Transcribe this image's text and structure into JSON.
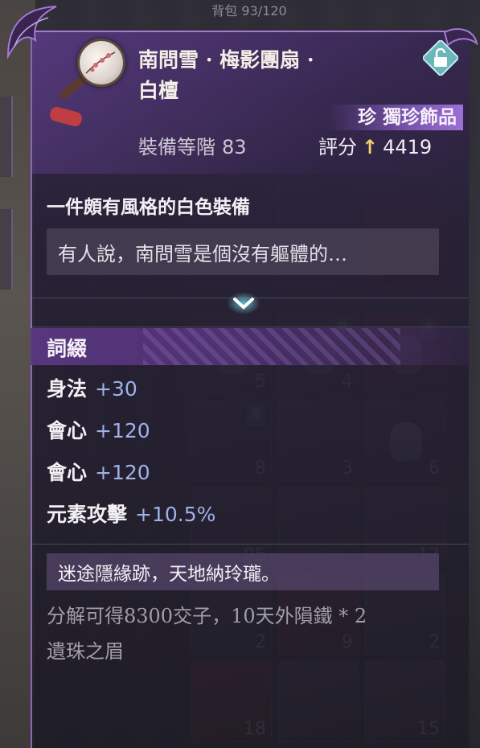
{
  "header": {
    "title_partial": "背包 93/120"
  },
  "item": {
    "name": "南問雪 · 梅影團扇 · 白檀",
    "quality": "珍 獨珍飾品",
    "equip_level_label": "裝備等階",
    "equip_level_value": "83",
    "score_label": "評分",
    "score_arrow": "↑",
    "score_value": "4419",
    "description_title": "一件頗有風格的白色裝備",
    "lore_text": "有人說，南問雪是個沒有軀體的…",
    "affix_title": "詞綴",
    "stats": [
      {
        "name": "身法",
        "value": "+30"
      },
      {
        "name": "會心",
        "value": "+120"
      },
      {
        "name": "會心",
        "value": "+120"
      },
      {
        "name": "元素攻擊",
        "value": "+10.5%"
      }
    ],
    "flavor_text": "迷途隱緣跡，天地納玲瓏。",
    "dismantle_text": "分解可得8300交子，10天外隕鐵 * 2",
    "dismantle_text_2": "遺珠之眉"
  },
  "inventory_counts": [
    "5",
    "4",
    "8",
    "3",
    "6",
    "95",
    "17",
    "2",
    "9",
    "2",
    "18",
    "15"
  ],
  "inventory_tags": [
    "易",
    "易",
    "易",
    "易"
  ],
  "icons": {
    "lock": "unlock-icon",
    "expand": "chevron-down-icon"
  },
  "colors": {
    "panel_border": "#8b68b6",
    "quality_badge": "#9c70d6",
    "stat_value": "#9fb1e8",
    "score_arrow": "#f1d26a"
  }
}
